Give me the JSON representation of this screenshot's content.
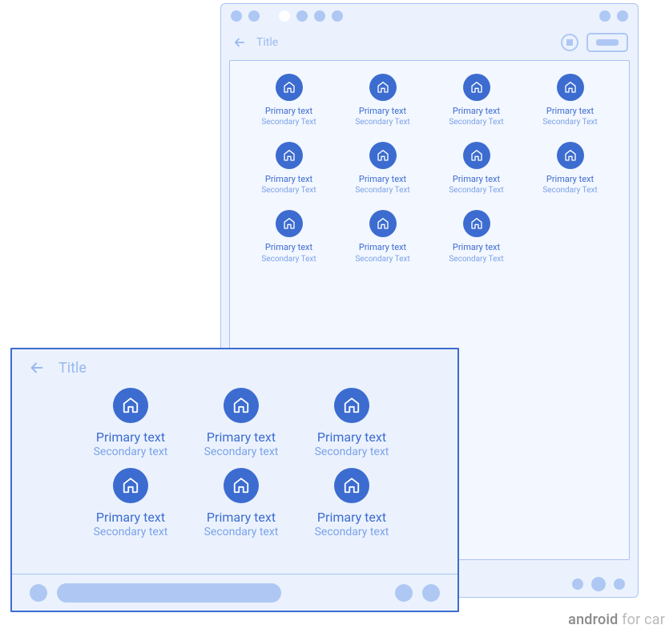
{
  "colors": {
    "panel_bg": "#ebf2fe",
    "inner_bg": "#f3f7ff",
    "border_light": "#aac4f2",
    "border_dark": "#3d6cd0",
    "dot": "#aec8f3",
    "accent": "#3c6cd0",
    "text_muted": "#99b8ef",
    "text_primary": "#3d6cd0",
    "text_secondary": "#7ba2e8"
  },
  "panelA": {
    "title": "Title",
    "icon_name": "home-icon",
    "items": [
      {
        "primary": "Primary text",
        "secondary": "Secondary Text"
      },
      {
        "primary": "Primary text",
        "secondary": "Secondary Text"
      },
      {
        "primary": "Primary text",
        "secondary": "Secondary Text"
      },
      {
        "primary": "Primary text",
        "secondary": "Secondary Text"
      },
      {
        "primary": "Primary text",
        "secondary": "Secondary Text"
      },
      {
        "primary": "Primary text",
        "secondary": "Secondary Text"
      },
      {
        "primary": "Primary text",
        "secondary": "Secondary Text"
      },
      {
        "primary": "Primary text",
        "secondary": "Secondary Text"
      },
      {
        "primary": "Primary text",
        "secondary": "Secondary Text"
      },
      {
        "primary": "Primary text",
        "secondary": "Secondary Text"
      },
      {
        "primary": "Primary text",
        "secondary": "Secondary Text"
      }
    ]
  },
  "panelB": {
    "title": "Title",
    "icon_name": "home-icon",
    "items": [
      {
        "primary": "Primary text",
        "secondary": "Secondary text"
      },
      {
        "primary": "Primary text",
        "secondary": "Secondary text"
      },
      {
        "primary": "Primary text",
        "secondary": "Secondary text"
      },
      {
        "primary": "Primary text",
        "secondary": "Secondary text"
      },
      {
        "primary": "Primary text",
        "secondary": "Secondary text"
      },
      {
        "primary": "Primary text",
        "secondary": "Secondary text"
      }
    ]
  },
  "watermark": {
    "bold": "android",
    "light": " for car"
  }
}
